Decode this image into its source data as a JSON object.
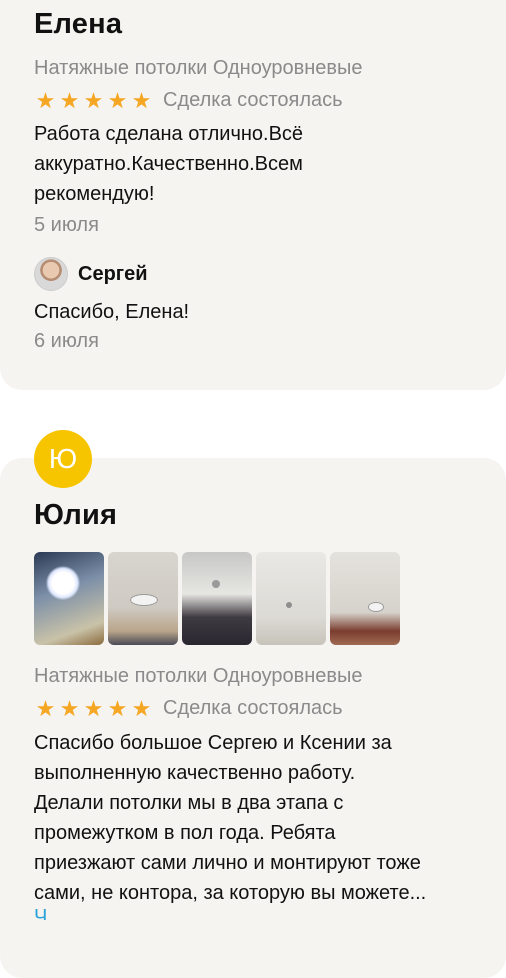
{
  "review1": {
    "name": "Елена",
    "category": "Натяжные потолки Одноуровневые",
    "stars": [
      "★",
      "★",
      "★",
      "★",
      "★"
    ],
    "rating": 5,
    "deal_status": "Сделка состоялась",
    "text_lines": [
      "Работа сделана отлично.Всё",
      "аккуратно.Качественно.Всем",
      "рекомендую!"
    ],
    "date": "5 июля",
    "reply": {
      "author": "Сергей",
      "text": "Спасибо, Елена!",
      "date": "6 июля"
    }
  },
  "review2": {
    "avatar_letter": "Ю",
    "avatar_color": "#f7c500",
    "name": "Юлия",
    "photos_count": 5,
    "category": "Натяжные потолки Одноуровневые",
    "stars": [
      "★",
      "★",
      "★",
      "★",
      "★"
    ],
    "rating": 5,
    "deal_status": "Сделка состоялась",
    "text_lines": [
      "Спасибо большое Сергею и Ксении за",
      "выполненную качественно работу.",
      "Делали потолки мы в два этапа с",
      "промежутком в пол года. Ребята",
      "приезжают сами лично и монтируют тоже",
      "сами, не контора, за которую вы можете..."
    ],
    "more_link": "Ч"
  },
  "colors": {
    "star": "#f5a623",
    "muted": "#8a8a8a",
    "card_bg": "#f5f4f1",
    "link": "#2aa3d8"
  }
}
